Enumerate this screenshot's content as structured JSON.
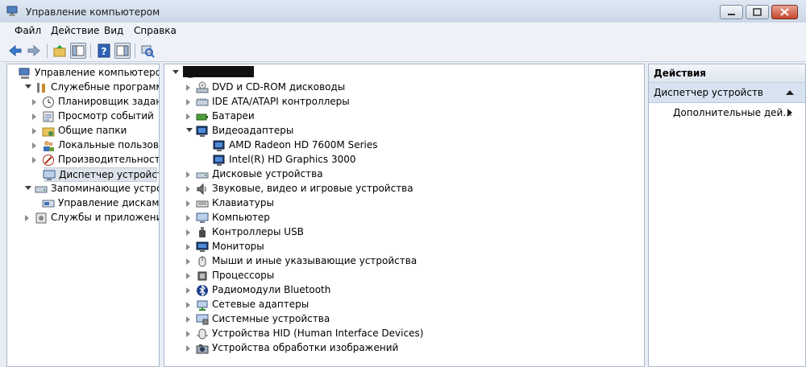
{
  "window": {
    "title": "Управление компьютером"
  },
  "menu": [
    "Файл",
    "Действие",
    "Вид",
    "Справка"
  ],
  "left_tree": [
    {
      "label": "Управление компьютером (л",
      "icon": "computer-management-icon",
      "level": 0,
      "expander": "none"
    },
    {
      "label": "Служебные программы",
      "icon": "tools-icon",
      "level": 1,
      "expander": "open"
    },
    {
      "label": "Планировщик заданий",
      "icon": "clock-icon",
      "level": 2,
      "expander": "closed"
    },
    {
      "label": "Просмотр событий",
      "icon": "event-viewer-icon",
      "level": 2,
      "expander": "closed"
    },
    {
      "label": "Общие папки",
      "icon": "shared-folder-icon",
      "level": 2,
      "expander": "closed"
    },
    {
      "label": "Локальные пользовате",
      "icon": "users-icon",
      "level": 2,
      "expander": "closed"
    },
    {
      "label": "Производительность",
      "icon": "performance-icon",
      "level": 2,
      "expander": "closed"
    },
    {
      "label": "Диспетчер устройств",
      "icon": "device-manager-icon",
      "level": 2,
      "expander": "none",
      "selected": true
    },
    {
      "label": "Запоминающие устройст",
      "icon": "storage-icon",
      "level": 1,
      "expander": "open"
    },
    {
      "label": "Управление дисками",
      "icon": "disk-management-icon",
      "level": 2,
      "expander": "none"
    },
    {
      "label": "Службы и приложения",
      "icon": "services-icon",
      "level": 1,
      "expander": "closed"
    }
  ],
  "device_tree": {
    "root_icon": "computer-icon",
    "items": [
      {
        "label": "DVD и CD-ROM дисководы",
        "icon": "dvd-drive-icon",
        "expander": "closed",
        "level": 1
      },
      {
        "label": "IDE ATA/ATAPI контроллеры",
        "icon": "ide-controller-icon",
        "expander": "closed",
        "level": 1
      },
      {
        "label": "Батареи",
        "icon": "battery-icon",
        "expander": "closed",
        "level": 1
      },
      {
        "label": "Видеоадаптеры",
        "icon": "display-adapter-icon",
        "expander": "open",
        "level": 1
      },
      {
        "label": "AMD Radeon HD 7600M Series",
        "icon": "display-adapter-icon",
        "expander": "none",
        "level": 2
      },
      {
        "label": "Intel(R) HD Graphics 3000",
        "icon": "display-adapter-icon",
        "expander": "none",
        "level": 2
      },
      {
        "label": "Дисковые устройства",
        "icon": "disk-drive-icon",
        "expander": "closed",
        "level": 1
      },
      {
        "label": "Звуковые, видео и игровые устройства",
        "icon": "speaker-icon",
        "expander": "closed",
        "level": 1
      },
      {
        "label": "Клавиатуры",
        "icon": "keyboard-icon",
        "expander": "closed",
        "level": 1
      },
      {
        "label": "Компьютер",
        "icon": "computer-icon",
        "expander": "closed",
        "level": 1
      },
      {
        "label": "Контроллеры USB",
        "icon": "usb-icon",
        "expander": "closed",
        "level": 1
      },
      {
        "label": "Мониторы",
        "icon": "monitor-icon",
        "expander": "closed",
        "level": 1
      },
      {
        "label": "Мыши и иные указывающие устройства",
        "icon": "mouse-icon",
        "expander": "closed",
        "level": 1
      },
      {
        "label": "Процессоры",
        "icon": "processor-icon",
        "expander": "closed",
        "level": 1
      },
      {
        "label": "Радиомодули Bluetooth",
        "icon": "bluetooth-icon",
        "expander": "closed",
        "level": 1
      },
      {
        "label": "Сетевые адаптеры",
        "icon": "network-adapter-icon",
        "expander": "closed",
        "level": 1
      },
      {
        "label": "Системные устройства",
        "icon": "system-devices-icon",
        "expander": "closed",
        "level": 1
      },
      {
        "label": "Устройства HID (Human Interface Devices)",
        "icon": "hid-icon",
        "expander": "closed",
        "level": 1
      },
      {
        "label": "Устройства обработки изображений",
        "icon": "imaging-device-icon",
        "expander": "closed",
        "level": 1
      }
    ]
  },
  "actions": {
    "header": "Действия",
    "section": "Диспетчер устройств",
    "more": "Дополнительные дей..."
  },
  "colors": {
    "selection": "#dde3ea",
    "actions_section": "#d7e3f1",
    "title_gradient_top": "#dfe8f3"
  }
}
